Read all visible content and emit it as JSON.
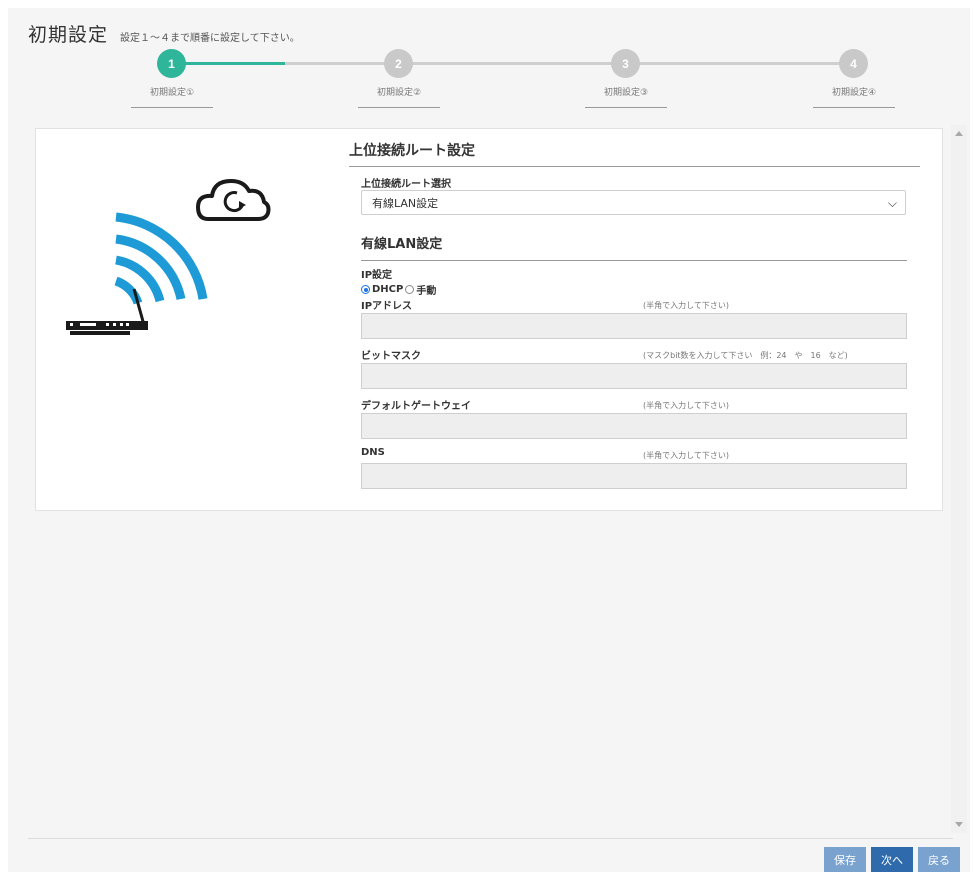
{
  "header": {
    "title": "初期設定",
    "subtitle": "設定１～４まで順番に設定して下さい。"
  },
  "stepper": {
    "steps": [
      {
        "number": "1",
        "label": "初期設定①",
        "active": true
      },
      {
        "number": "2",
        "label": "初期設定②",
        "active": false
      },
      {
        "number": "3",
        "label": "初期設定③",
        "active": false
      },
      {
        "number": "4",
        "label": "初期設定④",
        "active": false
      }
    ],
    "active_color": "#2fb59a",
    "inactive_color": "#c9c9c9"
  },
  "illustration": {
    "icons": [
      "cloud-sync-icon",
      "wifi-signal-icon",
      "router-icon"
    ],
    "wifi_color": "#1e9bd7"
  },
  "form": {
    "section_title": "上位接続ルート設定",
    "route_select": {
      "label": "上位接続ルート選択",
      "value": "有線LAN設定"
    },
    "wired_section_title": "有線LAN設定",
    "ip_setting": {
      "label": "IP設定",
      "options": [
        "DHCP",
        "手動"
      ],
      "selected": "DHCP"
    },
    "fields": [
      {
        "label": "IPアドレス",
        "hint": "(半角で入力して下さい)",
        "value": ""
      },
      {
        "label": "ビットマスク",
        "hint": "(マスクbit数を入力して下さい　例：24　や　16　など)",
        "value": ""
      },
      {
        "label": "デフォルトゲートウェイ",
        "hint": "(半角で入力して下さい)",
        "value": ""
      },
      {
        "label": "DNS",
        "hint": "(半角で入力して下さい)",
        "value": ""
      }
    ]
  },
  "footer": {
    "save_label": "保存",
    "next_label": "次へ",
    "back_label": "戻る"
  }
}
